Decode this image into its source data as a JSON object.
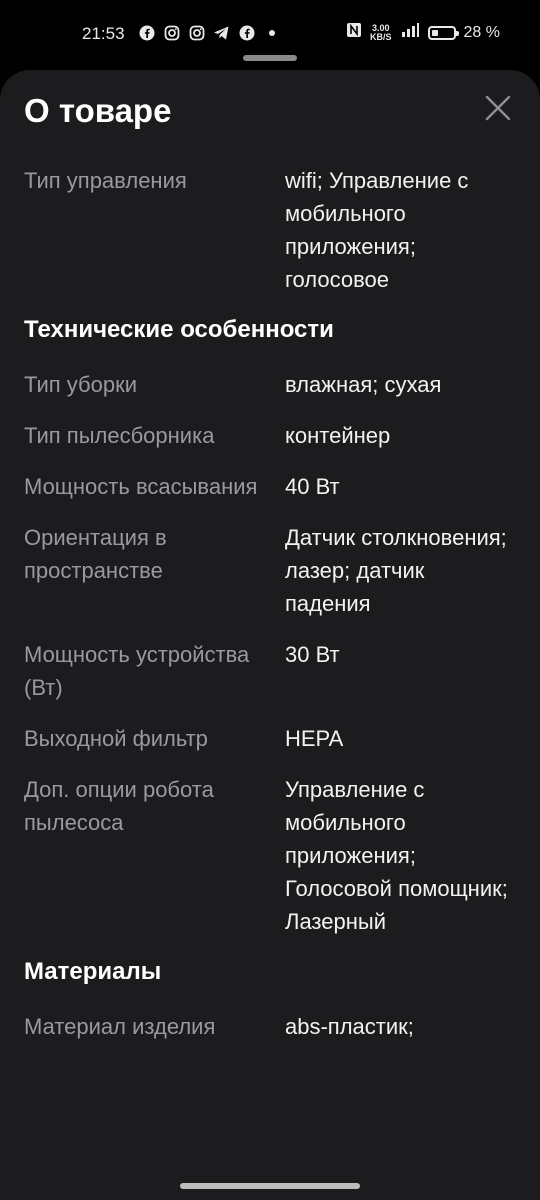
{
  "status_bar": {
    "time": "21:53",
    "net_speed_top": "3.00",
    "net_speed_bottom": "KB/S",
    "battery": "28 %",
    "battery_level_percent": 28,
    "notification_icons": [
      "facebook-icon",
      "instagram-icon",
      "instagram-icon",
      "telegram-icon",
      "facebook-icon",
      "dot-icon"
    ]
  },
  "sheet": {
    "title": "О товаре"
  },
  "rows_top": [
    {
      "label": "Тип управления",
      "value": "wifi; Управление с мобильного приложения; голосовое"
    }
  ],
  "sections": [
    {
      "title": "Технические особенности",
      "rows": [
        {
          "label": "Тип уборки",
          "value": "влажная; сухая"
        },
        {
          "label": "Тип пылесборника",
          "value": "контейнер"
        },
        {
          "label": "Мощность всасывания",
          "value": "40 Вт"
        },
        {
          "label": "Ориентация в пространстве",
          "value": "Датчик столкновения; лазер; датчик падения"
        },
        {
          "label": "Мощность устройства (Вт)",
          "value": "30 Вт"
        },
        {
          "label": "Выходной фильтр",
          "value": "HEPA"
        },
        {
          "label": "Доп. опции робота пылесоса",
          "value": "Управление с мобильного приложения; Голосовой помощник; Лазерный"
        }
      ]
    },
    {
      "title": "Материалы",
      "rows": [
        {
          "label": "Материал изделия",
          "value": "abs-пластик;"
        }
      ]
    }
  ],
  "colors": {
    "sheet_bg": "#1c1c1e",
    "label": "#9a9a9e",
    "value": "#f2f2f2"
  }
}
